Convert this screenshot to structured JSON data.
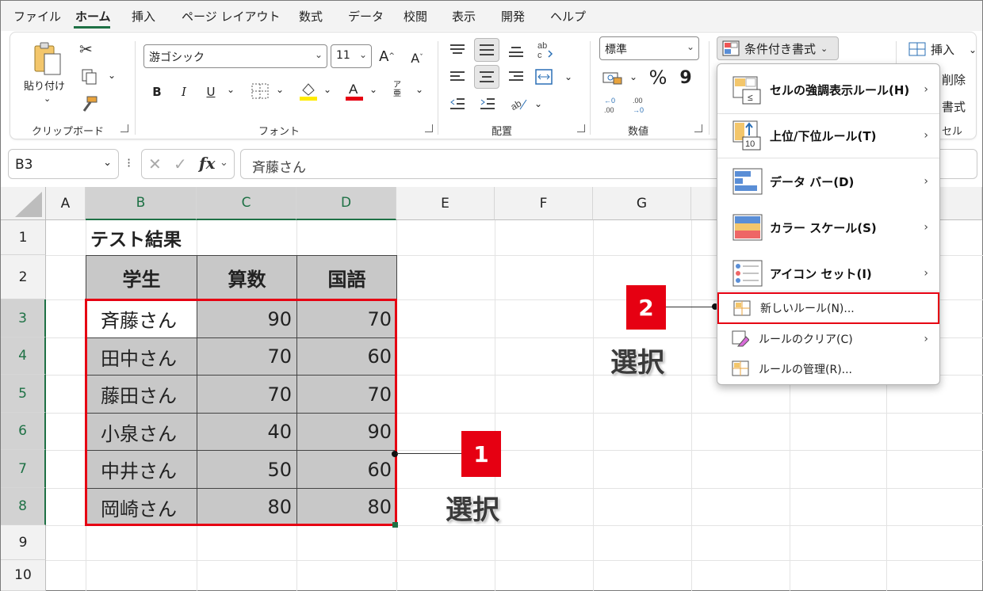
{
  "menubar": {
    "tabs": [
      "ファイル",
      "ホーム",
      "挿入",
      "ページ レイアウト",
      "数式",
      "データ",
      "校閲",
      "表示",
      "開発",
      "ヘルプ"
    ]
  },
  "ribbon": {
    "clipboard": {
      "paste_label": "貼り付け",
      "group_label": "クリップボード"
    },
    "font": {
      "font_name": "游ゴシック",
      "font_size": "11",
      "group_label": "フォント",
      "bold": "B",
      "italic": "I",
      "underline": "U",
      "ruby": "ア亜"
    },
    "alignment": {
      "group_label": "配置"
    },
    "number": {
      "format": "標準",
      "percent": "%",
      "comma": "9",
      "group_label": "数値"
    },
    "styles": {
      "conditional_formatting": "条件付き書式"
    },
    "cells": {
      "insert": "挿入",
      "delete_partial": "削除",
      "format_partial": "書式",
      "group_label_partial": "セル"
    }
  },
  "formula_bar": {
    "name_box": "B3",
    "fx": "fx",
    "content": "斉藤さん"
  },
  "sheet": {
    "columns": [
      "A",
      "B",
      "C",
      "D",
      "E",
      "F",
      "G"
    ],
    "rows": [
      "1",
      "2",
      "3",
      "4",
      "5",
      "6",
      "7",
      "8",
      "9",
      "10"
    ],
    "title": "テスト結果",
    "headers": [
      "学生",
      "算数",
      "国語"
    ],
    "data": [
      [
        "斉藤さん",
        "90",
        "70"
      ],
      [
        "田中さん",
        "70",
        "60"
      ],
      [
        "藤田さん",
        "70",
        "70"
      ],
      [
        "小泉さん",
        "40",
        "90"
      ],
      [
        "中井さん",
        "50",
        "60"
      ],
      [
        "岡崎さん",
        "80",
        "80"
      ]
    ]
  },
  "dropdown_menu": {
    "items": [
      {
        "label": "セルの強調表示ルール(H)",
        "icon": "highlight-cells-icon",
        "submenu": true
      },
      {
        "label": "上位/下位ルール(T)",
        "icon": "top-bottom-icon",
        "submenu": true
      },
      {
        "label": "データ バー(D)",
        "icon": "data-bars-icon",
        "submenu": true
      },
      {
        "label": "カラー スケール(S)",
        "icon": "color-scales-icon",
        "submenu": true
      },
      {
        "label": "アイコン セット(I)",
        "icon": "icon-sets-icon",
        "submenu": true
      },
      {
        "label": "新しいルール(N)...",
        "icon": "new-rule-icon",
        "submenu": false
      },
      {
        "label": "ルールのクリア(C)",
        "icon": "clear-rules-icon",
        "submenu": true
      },
      {
        "label": "ルールの管理(R)...",
        "icon": "manage-rules-icon",
        "submenu": false
      }
    ]
  },
  "annotations": {
    "callout1": "1",
    "callout2": "2",
    "select_text_1": "選択",
    "select_text_2": "選択"
  },
  "colors": {
    "accent_green": "#1e7145",
    "highlight_red": "#e60012",
    "selection_gray": "#c8c8c8"
  }
}
